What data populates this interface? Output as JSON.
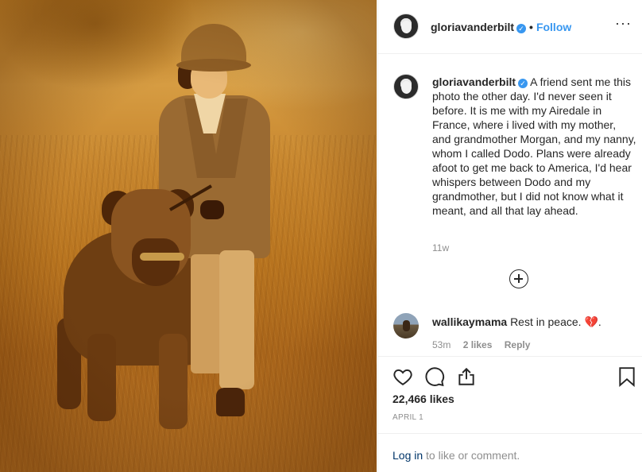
{
  "post": {
    "image_alt": "Sepia photo of a young girl in a tweed coat and cloche hat standing in a field beside an Airedale terrier on a leash",
    "header": {
      "username": "gloriavanderbilt",
      "separator": "•",
      "follow_label": "Follow",
      "more_icon": "more-options-icon",
      "verified_icon": "verified-badge-icon"
    },
    "caption": {
      "username": "gloriavanderbilt",
      "text": "A friend sent me this photo the other day. I'd never seen it before. It is me with my Airedale in France, where i lived with my mother, and grandmother Morgan, and my nanny, whom I called Dodo. Plans were already afoot to get me back to America, I'd hear whispers between Dodo and my grandmother, but I did not know what it meant, and all that lay ahead.",
      "time": "11w"
    },
    "load_more_icon": "plus-circle-icon",
    "comments": [
      {
        "username": "wallikaymama",
        "text": "Rest in peace. 💔.",
        "time": "53m",
        "likes": "2 likes",
        "reply": "Reply"
      }
    ],
    "actions": {
      "like_icon": "heart-icon",
      "comment_icon": "comment-bubble-icon",
      "share_icon": "share-icon",
      "save_icon": "bookmark-icon"
    },
    "likes": "22,466 likes",
    "date": "APRIL 1",
    "login_prompt": {
      "link": "Log in",
      "rest": " to like or comment."
    }
  },
  "colors": {
    "accent": "#3897f0",
    "text": "#262626",
    "muted": "#8e8e8e",
    "border": "#efefef",
    "login_link": "#003569"
  }
}
